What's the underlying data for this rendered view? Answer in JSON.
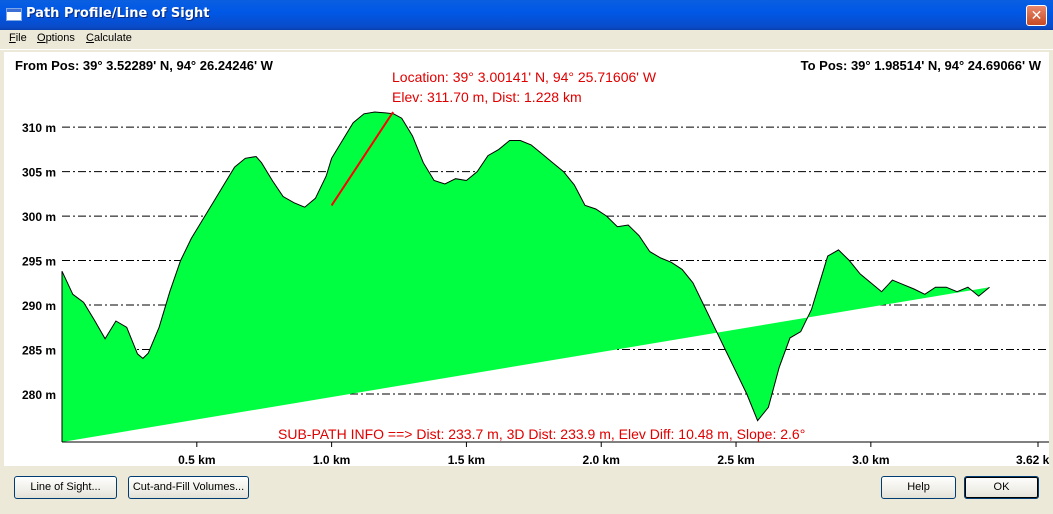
{
  "window": {
    "title": "Path Profile/Line of Sight",
    "close": "✕"
  },
  "menu": [
    {
      "label": "File"
    },
    {
      "label": "Options"
    },
    {
      "label": "Calculate"
    }
  ],
  "profile": {
    "from_pos": "From Pos: 39° 3.52289' N, 94° 26.24246' W",
    "to_pos": "To Pos: 39° 1.98514' N, 94° 24.69066' W",
    "location_text": "Location: 39° 3.00141' N, 94° 25.71606' W",
    "elev_text": "Elev: 311.70 m, Dist: 1.228 km",
    "subpath_text": "SUB-PATH INFO ==> Dist: 233.7 m, 3D Dist: 233.9 m, Elev Diff: 10.48 m, Slope: 2.6°",
    "fill_color": "#00ff40",
    "line_color": "#ff0000"
  },
  "chart_data": {
    "type": "area",
    "ylabel_ticks": [
      "310 m",
      "305 m",
      "300 m",
      "295 m",
      "290 m",
      "285 m",
      "280 m"
    ],
    "y_ticks": [
      310,
      305,
      300,
      295,
      290,
      285,
      280
    ],
    "xlabel_ticks": [
      "0.5 km",
      "1.0 km",
      "1.5 km",
      "2.0 km",
      "2.5 km",
      "3.0 km",
      "3.62 km"
    ],
    "x_ticks": [
      0.5,
      1.0,
      1.5,
      2.0,
      2.5,
      3.0,
      3.62
    ],
    "xlim": [
      0,
      3.62
    ],
    "ylim": [
      274.6,
      311.7
    ],
    "grid": true,
    "x": [
      0,
      0.04,
      0.08,
      0.12,
      0.16,
      0.2,
      0.24,
      0.28,
      0.3,
      0.32,
      0.36,
      0.4,
      0.44,
      0.48,
      0.52,
      0.56,
      0.6,
      0.64,
      0.68,
      0.72,
      0.74,
      0.78,
      0.82,
      0.86,
      0.9,
      0.94,
      0.98,
      1.0,
      1.04,
      1.08,
      1.12,
      1.16,
      1.2,
      1.23,
      1.26,
      1.3,
      1.34,
      1.38,
      1.42,
      1.46,
      1.5,
      1.54,
      1.58,
      1.62,
      1.66,
      1.7,
      1.74,
      1.78,
      1.82,
      1.86,
      1.9,
      1.94,
      1.98,
      2.02,
      2.06,
      2.1,
      2.14,
      2.18,
      2.22,
      2.26,
      2.3,
      2.34,
      2.38,
      2.42,
      2.46,
      2.5,
      2.54,
      2.58,
      2.62,
      2.66,
      2.7,
      2.74,
      2.78,
      2.81,
      2.84,
      2.88,
      2.92,
      2.96,
      3.0,
      3.04,
      3.08,
      3.12,
      3.16,
      3.2,
      3.24,
      3.28,
      3.32,
      3.36,
      3.4,
      3.44,
      3.48,
      3.52,
      3.56,
      3.6,
      3.62
    ],
    "y": [
      293.8,
      291.2,
      290.3,
      288.3,
      286.2,
      288.2,
      287.5,
      284.5,
      284.0,
      284.6,
      287.5,
      291.5,
      295.0,
      297.5,
      299.5,
      301.5,
      303.5,
      305.5,
      306.5,
      306.7,
      306.0,
      304.0,
      302.2,
      301.5,
      301.0,
      302.0,
      304.5,
      306.5,
      308.5,
      310.5,
      311.5,
      311.7,
      311.6,
      311.5,
      311.0,
      309.0,
      306.0,
      304.0,
      303.6,
      304.2,
      304.0,
      305.0,
      306.8,
      307.5,
      308.5,
      308.5,
      308.0,
      307.0,
      306.0,
      305.0,
      303.5,
      301.2,
      300.8,
      300.0,
      298.8,
      299.0,
      297.8,
      296.0,
      295.3,
      294.8,
      294.0,
      292.5,
      290.0,
      287.5,
      285.0,
      282.5,
      280.0,
      277.0,
      278.5,
      283.0,
      286.3,
      287.0,
      289.5,
      292.5,
      295.5,
      296.2,
      295.0,
      293.5,
      292.5,
      291.5,
      292.8,
      292.3,
      291.8,
      291.2,
      292.0,
      292.0,
      291.5,
      292.0,
      291.0,
      292.0
    ],
    "sub_path": {
      "x": [
        1.0,
        1.228
      ],
      "y": [
        301.2,
        311.7
      ]
    }
  },
  "buttons": {
    "line_of_sight": "Line of Sight...",
    "cut_fill": "Cut-and-Fill Volumes...",
    "help": "Help",
    "ok": "OK"
  }
}
